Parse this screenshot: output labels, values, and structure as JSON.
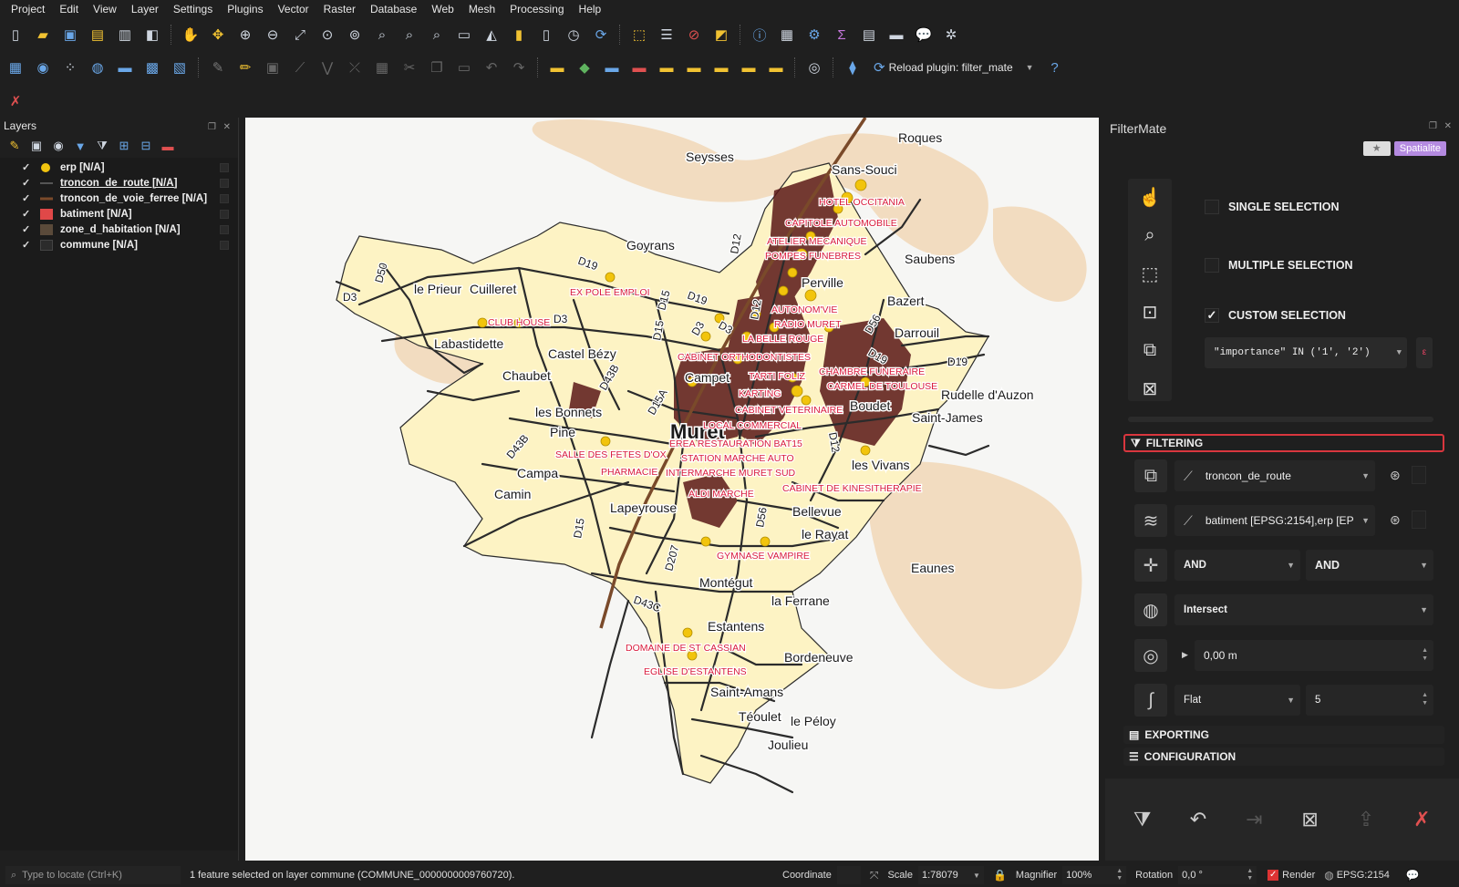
{
  "menu": [
    "Project",
    "Edit",
    "View",
    "Layer",
    "Settings",
    "Plugins",
    "Vector",
    "Raster",
    "Database",
    "Web",
    "Mesh",
    "Processing",
    "Help"
  ],
  "toolbar": {
    "reload_label": "Reload plugin: filter_mate",
    "icons_row1": [
      "new-project-icon",
      "open-project-icon",
      "save-project-icon",
      "save-as-icon",
      "print-layout-icon",
      "style-manager-icon",
      "pan-icon",
      "pan-to-selection-icon",
      "zoom-in-icon",
      "zoom-out-icon",
      "zoom-full-icon",
      "zoom-selection-icon",
      "zoom-layer-icon",
      "zoom-native-icon",
      "zoom-last-icon",
      "zoom-next-icon",
      "new-map-view-icon",
      "new-3d-view-icon",
      "new-bookmark-icon",
      "show-bookmarks-icon",
      "temporal-icon",
      "refresh-icon",
      "select-features-icon",
      "select-by-value-icon",
      "deselect-icon",
      "select-location-icon",
      "identify-icon",
      "attribute-table-icon",
      "toolbox-icon",
      "statistics-icon",
      "field-calc-icon",
      "measure-icon",
      "map-tips-icon",
      "annotation-icon"
    ],
    "icons_row2": [
      "data-source-manager-icon",
      "new-gpkg-icon",
      "new-shapefile-icon",
      "new-spatialite-icon",
      "new-virtual-icon",
      "new-temp-icon",
      "new-mesh-icon",
      "edits-icon",
      "toggle-edit-icon",
      "save-edits-icon",
      "digitize-icon",
      "vertex-icon",
      "multi-edit-icon",
      "delete-icon",
      "cut-icon",
      "copy-icon",
      "paste-icon",
      "undo-icon",
      "redo-icon",
      "label-tool-icon",
      "diagram-icon",
      "pin-label-icon",
      "show-label-icon",
      "move-label-icon",
      "rotate-label-icon",
      "change-label-icon",
      "python-icon",
      "help-icon"
    ]
  },
  "layers_panel": {
    "title": "Layers",
    "layers": [
      {
        "name": "erp [N/A]",
        "checked": "✓",
        "symbol": "point",
        "color": "#f1c40f",
        "underline": false
      },
      {
        "name": "troncon_de_route [N/A]",
        "checked": "✓",
        "symbol": "line",
        "color": "#555555",
        "underline": true
      },
      {
        "name": "troncon_de_voie_ferree [N/A]",
        "checked": "✓",
        "symbol": "line",
        "color": "#7a4a2a",
        "underline": false
      },
      {
        "name": "batiment [N/A]",
        "checked": "✓",
        "symbol": "fill",
        "color": "#e04848",
        "underline": false
      },
      {
        "name": "zone_d_habitation [N/A]",
        "checked": "✓",
        "symbol": "fill",
        "color": "#5a4a3a",
        "underline": false
      },
      {
        "name": "commune [N/A]",
        "checked": "✓",
        "symbol": "fill",
        "color": "#2b2b2b",
        "underline": false
      }
    ]
  },
  "map": {
    "places": [
      {
        "text": "Roques"
      },
      {
        "text": "Seysses"
      },
      {
        "text": "Sans-Souci"
      },
      {
        "text": "Goyrans"
      },
      {
        "text": "Saubens"
      },
      {
        "text": "le Prieur"
      },
      {
        "text": "Cuilleret"
      },
      {
        "text": "Perville"
      },
      {
        "text": "Bazert"
      },
      {
        "text": "Darrouil"
      },
      {
        "text": "Labastidette"
      },
      {
        "text": "Castel Bézy"
      },
      {
        "text": "Chaubet"
      },
      {
        "text": "Campet"
      },
      {
        "text": "Rudelle d'Auzon"
      },
      {
        "text": "Boudet"
      },
      {
        "text": "Saint-James"
      },
      {
        "text": "les Bonnets"
      },
      {
        "text": "Pine"
      },
      {
        "text": "Muret"
      },
      {
        "text": "les Vivans"
      },
      {
        "text": "Campa"
      },
      {
        "text": "Camin"
      },
      {
        "text": "Lapeyrouse"
      },
      {
        "text": "Bellevue"
      },
      {
        "text": "le Rayat"
      },
      {
        "text": "Eaunes"
      },
      {
        "text": "Montégut"
      },
      {
        "text": "la Ferrane"
      },
      {
        "text": "Estantens"
      },
      {
        "text": "Bordeneuve"
      },
      {
        "text": "Saint-Amans"
      },
      {
        "text": "Téoulet"
      },
      {
        "text": "le Péloy"
      },
      {
        "text": "Joulieu"
      }
    ],
    "pois": [
      {
        "text": "HOTEL OCCITANIA"
      },
      {
        "text": "CAPITOLE AUTOMOBILE"
      },
      {
        "text": "ATELIER MECANIQUE"
      },
      {
        "text": "POMPES FUNEBRES"
      },
      {
        "text": "EX POLE EMPLOI"
      },
      {
        "text": "CLUB HOUSE"
      },
      {
        "text": "AUTONOM'VIE"
      },
      {
        "text": "RADIO MURET"
      },
      {
        "text": "LA BELLE ROUGE"
      },
      {
        "text": "CABINET ORTHODONTISTES"
      },
      {
        "text": "CHAMBRE FUNERAIRE"
      },
      {
        "text": "TARTI FOLIZ"
      },
      {
        "text": "CARMEL DE TOULOUSE"
      },
      {
        "text": "KARTING"
      },
      {
        "text": "CABINET VETERINAIRE"
      },
      {
        "text": "LOCAL COMMERCIAL"
      },
      {
        "text": "EREA RESTAURATION BAT15"
      },
      {
        "text": "SALLE DES FETES D'OX"
      },
      {
        "text": "STATION MARCHE AUTO"
      },
      {
        "text": "PHARMACIE"
      },
      {
        "text": "INTERMARCHE MURET SUD"
      },
      {
        "text": "CABINET DE KINESITHERAPIE"
      },
      {
        "text": "ALDI MARCHE"
      },
      {
        "text": "GYMNASE VAMPIRE"
      },
      {
        "text": "DOMAINE DE ST CASSIAN"
      },
      {
        "text": "EGLISE D'ESTANTENS"
      }
    ],
    "roads": [
      {
        "text": "D50"
      },
      {
        "text": "D3"
      },
      {
        "text": "D19"
      },
      {
        "text": "D15"
      },
      {
        "text": "D12"
      },
      {
        "text": "D19"
      },
      {
        "text": "D3"
      },
      {
        "text": "D15"
      },
      {
        "text": "D3"
      },
      {
        "text": "D3"
      },
      {
        "text": "D12"
      },
      {
        "text": "D56"
      },
      {
        "text": "D19"
      },
      {
        "text": "D19"
      },
      {
        "text": "D43B"
      },
      {
        "text": "D15A"
      },
      {
        "text": "D43B"
      },
      {
        "text": "D12"
      },
      {
        "text": "D15"
      },
      {
        "text": "D56"
      },
      {
        "text": "D207"
      },
      {
        "text": "D43C"
      }
    ],
    "colors": {
      "commune": "#fdf3c4",
      "habitation": "#f2dcc0",
      "road": "#2b2b2b",
      "building": "#5a1818",
      "erp": "#f2c40c"
    }
  },
  "filtermate": {
    "title": "FilterMate",
    "badge_star": "★",
    "badge_db": "Spatialite",
    "single_selection": "SINGLE SELECTION",
    "multiple_selection": "MULTIPLE SELECTION",
    "custom_selection": "CUSTOM SELECTION",
    "custom_checked": "✓",
    "expression": "\"importance\" IN ('1', '2')",
    "filtering_label": "FILTERING",
    "source_layer": "troncon_de_route",
    "target_layers": "batiment [EPSG:2154],erp [EP",
    "combine_op1": "AND",
    "combine_op2": "AND",
    "predicate": "Intersect",
    "buffer_value": "0,00 m",
    "buffer_type": "Flat",
    "segments": "5",
    "exporting_label": "EXPORTING",
    "configuration_label": "CONFIGURATION"
  },
  "statusbar": {
    "locator_placeholder": "Type to locate (Ctrl+K)",
    "message": "1 feature selected on layer commune (COMMUNE_0000000009760720).",
    "coordinate_label": "Coordinate",
    "scale_label": "Scale",
    "scale_value": "1:78079",
    "magnifier_label": "Magnifier",
    "magnifier_value": "100%",
    "rotation_label": "Rotation",
    "rotation_value": "0,0 °",
    "render_label": "Render",
    "crs": "EPSG:2154"
  }
}
